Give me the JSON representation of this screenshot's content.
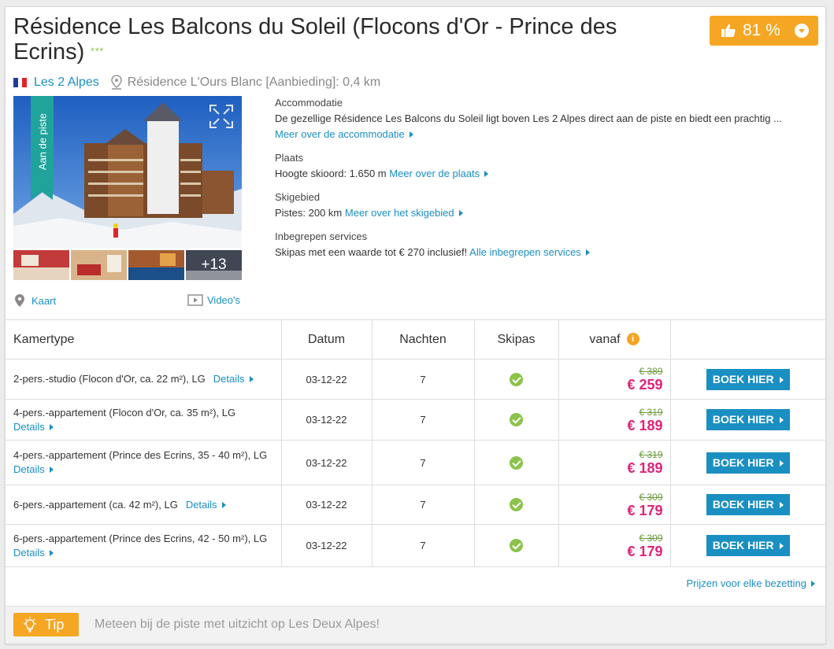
{
  "listing": {
    "title": "Résidence Les Balcons du Soleil (Flocons d'Or - Prince des Ecrins)",
    "stars": "***",
    "rating": "81 %",
    "location": "Les 2 Alpes",
    "nearby": "Résidence L'Ours Blanc [Aanbieding]: 0,4 km",
    "ribbon": "Aan de piste",
    "more_photos": "+13",
    "map_label": "Kaart",
    "video_label": "Video's"
  },
  "info": {
    "accommodation_heading": "Accommodatie",
    "accommodation_text": "De gezellige Résidence Les Balcons du Soleil ligt boven Les 2 Alpes direct aan de piste en biedt een prachtig ...",
    "accommodation_link": "Meer over de accommodatie",
    "place_heading": "Plaats",
    "place_text": "Hoogte skioord: 1.650 m",
    "place_link": "Meer over de plaats",
    "ski_heading": "Skigebied",
    "ski_text": "Pistes: 200 km",
    "ski_link": "Meer over het skigebied",
    "services_heading": "Inbegrepen services",
    "services_text": "Skipas met een waarde tot € 270 inclusief!",
    "services_link": "Alle inbegrepen services"
  },
  "table": {
    "headers": {
      "type": "Kamertype",
      "date": "Datum",
      "nights": "Nachten",
      "skipass": "Skipas",
      "from": "vanaf",
      "info_icon": "i"
    },
    "details_label": "Details",
    "book_label": "BOEK HIER",
    "rows": [
      {
        "type": "2-pers.-studio (Flocon d'Or, ca. 22 m²), LG",
        "date": "03-12-22",
        "nights": "7",
        "old": "€ 389",
        "new": "€ 259"
      },
      {
        "type": "4-pers.-appartement (Flocon d'Or, ca. 35 m²), LG",
        "date": "03-12-22",
        "nights": "7",
        "old": "€ 319",
        "new": "€ 189"
      },
      {
        "type": "4-pers.-appartement (Prince des Ecrins, 35 - 40 m²), LG",
        "date": "03-12-22",
        "nights": "7",
        "old": "€ 319",
        "new": "€ 189"
      },
      {
        "type": "6-pers.-appartement (ca. 42 m²), LG",
        "date": "03-12-22",
        "nights": "7",
        "old": "€ 309",
        "new": "€ 179"
      },
      {
        "type": "6-pers.-appartement (Prince des Ecrins, 42 - 50 m²), LG",
        "date": "03-12-22",
        "nights": "7",
        "old": "€ 309",
        "new": "€ 179"
      }
    ]
  },
  "prices_link": "Prijzen voor elke bezetting",
  "tip": {
    "label": "Tip",
    "text": "Meteen bij de piste met uitzicht op Les Deux Alpes!"
  },
  "colors": {
    "accent_orange": "#f5a623",
    "link_blue": "#1a8fc2",
    "price_pink": "#e0227a",
    "ribbon_teal": "#1fa39a",
    "check_green": "#8bc34a"
  }
}
